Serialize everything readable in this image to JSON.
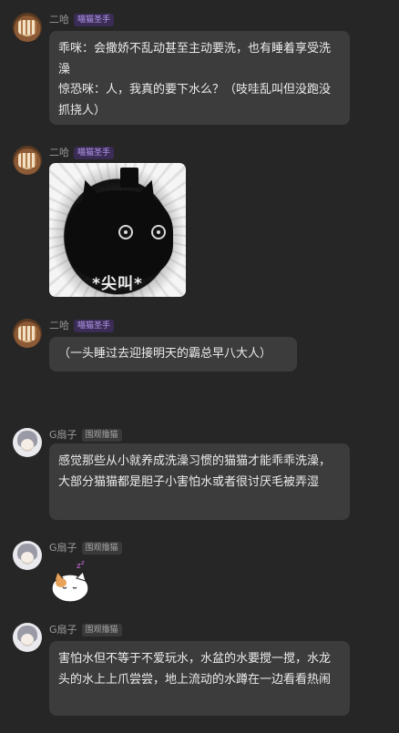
{
  "messages": [
    {
      "name": "二哈",
      "badge": "喵猫圣手",
      "lines": [
        "乖咪：会撒娇不乱动甚至主动要洗，也有睡着享受洗澡",
        "惊恐咪：人，我真的要下水么？（吱哇乱叫但没跑没抓挠人）"
      ]
    },
    {
      "name": "二哈",
      "badge": "喵猫圣手",
      "image_caption": "*尖叫*"
    },
    {
      "name": "二哈",
      "badge": "喵猫圣手",
      "text": "（一头睡过去迎接明天的霸总早八大人）"
    },
    {
      "name": "G扇子",
      "badge": "围观撸猫",
      "text": "感觉那些从小就养成洗澡习惯的猫猫才能乖乖洗澡，大部分猫猫都是胆子小害怕水或者很讨厌毛被弄湿"
    },
    {
      "name": "G扇子",
      "badge": "围观撸猫",
      "sticker": "sleepy-cat-sticker"
    },
    {
      "name": "G扇子",
      "badge": "围观撸猫",
      "text": "害怕水但不等于不爱玩水，水盆的水要搅一搅，水龙头的水上上爪尝尝，地上流动的水蹲在一边看看热闹"
    }
  ],
  "colors": {
    "background": "#262626",
    "bubble": "#3c3c3c",
    "badge_purple_bg": "#3a2c55",
    "badge_purple_text": "#b79cf0",
    "badge_gray_bg": "#3a3a3a"
  }
}
